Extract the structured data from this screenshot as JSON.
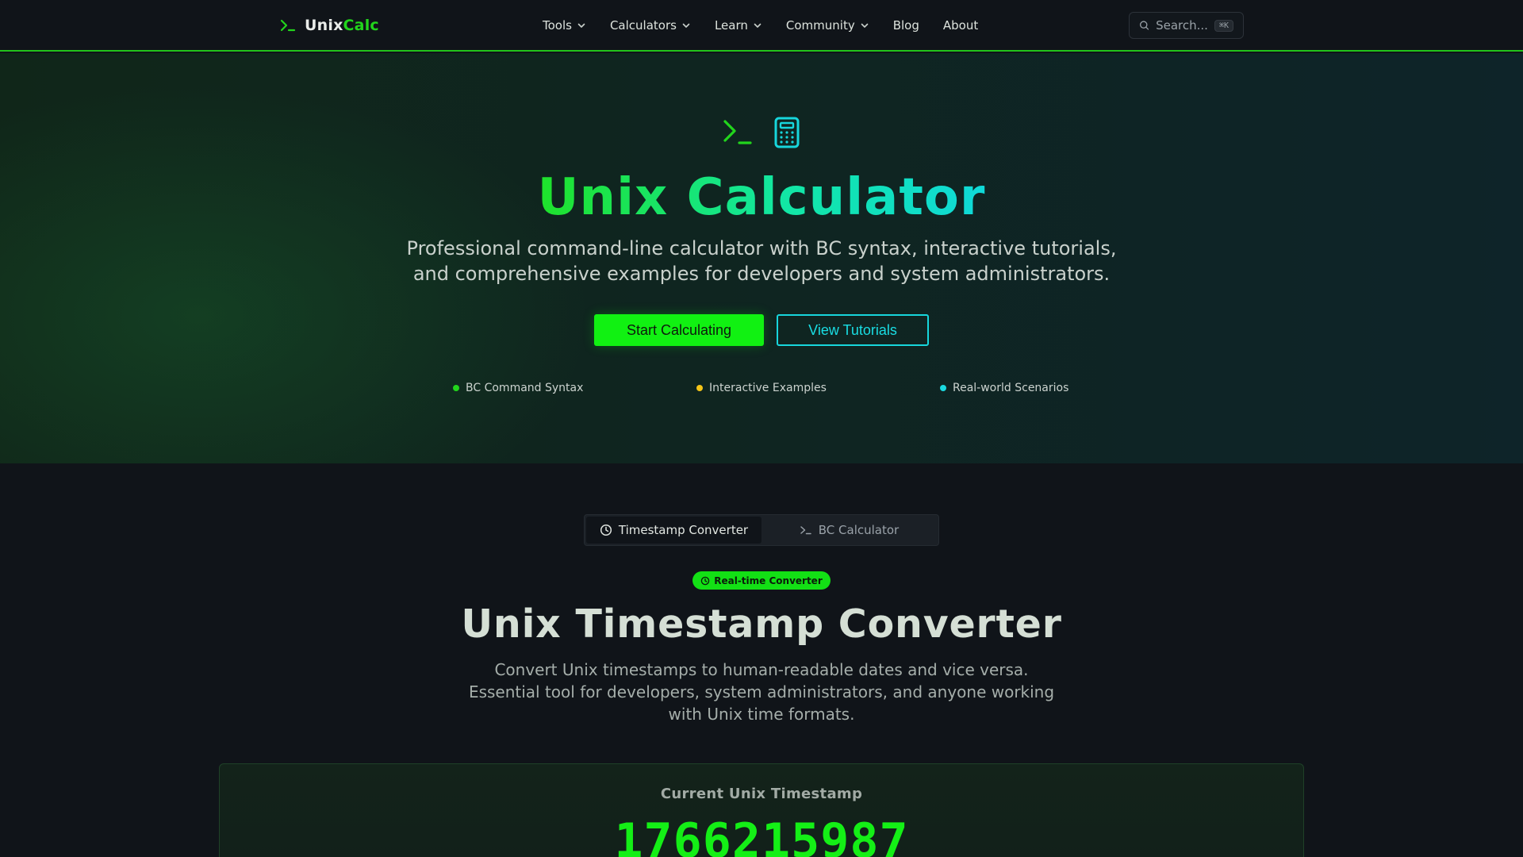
{
  "brand": {
    "name_part1": "Unix",
    "name_part2": "Calc"
  },
  "nav": {
    "items": [
      {
        "label": "Tools",
        "dropdown": true
      },
      {
        "label": "Calculators",
        "dropdown": true
      },
      {
        "label": "Learn",
        "dropdown": true
      },
      {
        "label": "Community",
        "dropdown": true
      },
      {
        "label": "Blog",
        "dropdown": false
      },
      {
        "label": "About",
        "dropdown": false
      }
    ]
  },
  "search": {
    "placeholder": "Search...",
    "shortcut": "⌘K"
  },
  "hero": {
    "title": "Unix Calculator",
    "subtitle_line1": "Professional command-line calculator with BC syntax, interactive tutorials,",
    "subtitle_line2": "and comprehensive examples for developers and system administrators.",
    "primary_button": "Start Calculating",
    "secondary_button": "View Tutorials",
    "features": [
      {
        "label": "BC Command Syntax",
        "color": "#22d51c"
      },
      {
        "label": "Interactive Examples",
        "color": "#f5c518"
      },
      {
        "label": "Real-world Scenarios",
        "color": "#1ad9e0"
      }
    ]
  },
  "tabs": [
    {
      "label": "Timestamp Converter",
      "icon": "clock-icon",
      "active": true
    },
    {
      "label": "BC Calculator",
      "icon": "terminal-icon",
      "active": false
    }
  ],
  "converter": {
    "badge": "Real-time Converter",
    "title": "Unix Timestamp Converter",
    "desc_line1": "Convert Unix timestamps to human-readable dates and vice versa.",
    "desc_line2": "Essential tool for developers, system administrators, and anyone working",
    "desc_line3": "with Unix time formats.",
    "current_label": "Current Unix Timestamp",
    "current_value": "1766215987"
  },
  "colors": {
    "accent_green": "#11f112",
    "accent_cyan": "#17d6dc",
    "header_border": "#22c31b"
  }
}
